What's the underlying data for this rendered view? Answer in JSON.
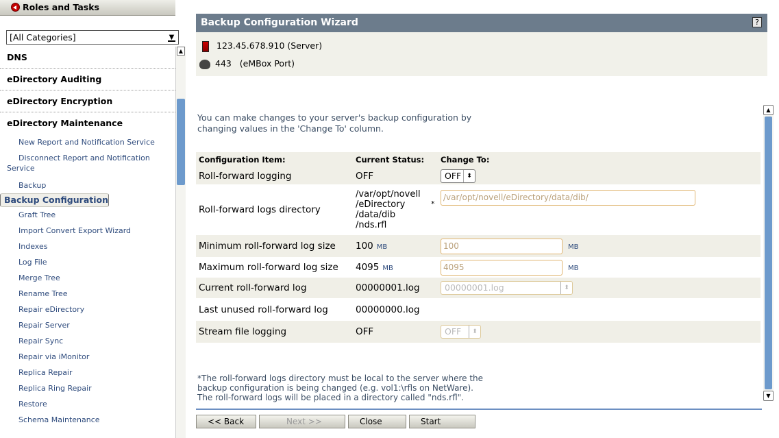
{
  "sidebar": {
    "header": "Roles and Tasks",
    "category_selected": "[All Categories]",
    "categories": [
      {
        "label": "DNS"
      },
      {
        "label": "eDirectory Auditing"
      },
      {
        "label": "eDirectory Encryption"
      },
      {
        "label": "eDirectory Maintenance"
      }
    ],
    "tasks": [
      "New Report and Notification Service",
      "Disconnect Report and Notification",
      "Service",
      "Backup",
      "Backup Configuration",
      "Graft Tree",
      "Import Convert Export Wizard",
      "Indexes",
      "Log File",
      "Merge Tree",
      "Rename Tree",
      "Repair eDirectory",
      "Repair Server",
      "Repair Sync",
      "Repair via iMonitor",
      "Replica Repair",
      "Replica Ring Repair",
      "Restore",
      "Schema Maintenance"
    ]
  },
  "wizard": {
    "title": "Backup Configuration Wizard",
    "help": "?",
    "server_line": "123.45.678.910 (Server)",
    "port_value": "443",
    "port_label": "(eMBox Port)",
    "intro_line1": "You can make changes to your server's backup configuration by",
    "intro_line2": "changing values in the 'Change To' column.",
    "headers": {
      "item": "Configuration Item:",
      "status": "Current Status:",
      "change": "Change To:"
    },
    "rows": [
      {
        "item": "Roll-forward logging",
        "status": "OFF",
        "change": "OFF"
      },
      {
        "item": "Roll-forward logs directory",
        "status_lines": [
          "/var/opt/novell",
          "/eDirectory",
          "/data/dib",
          "/nds.rfl"
        ],
        "marker": "*",
        "change": "/var/opt/novell/eDirectory/data/dib/"
      },
      {
        "item": "Minimum roll-forward log size",
        "status": "100",
        "unit": "MB",
        "change": "100",
        "change_unit": "MB"
      },
      {
        "item": "Maximum roll-forward log size",
        "status": "4095",
        "unit": "MB",
        "change": "4095",
        "change_unit": "MB"
      },
      {
        "item": "Current roll-forward log",
        "status": "00000001.log",
        "change": "00000001.log"
      },
      {
        "item": "Last unused roll-forward log",
        "status": "00000000.log"
      },
      {
        "item": "Stream file logging",
        "status": "OFF",
        "change": "OFF"
      }
    ],
    "note_line1": "*The roll-forward logs directory must be local to the server where the",
    "note_line2": "backup configuration is being changed (e.g. vol1:\\rfls on NetWare).",
    "note_line3": "The roll-forward logs will be placed in a directory called \"nds.rfl\".",
    "buttons": {
      "back": "<< Back",
      "next": "Next >>",
      "close": "Close",
      "start": "Start"
    }
  }
}
